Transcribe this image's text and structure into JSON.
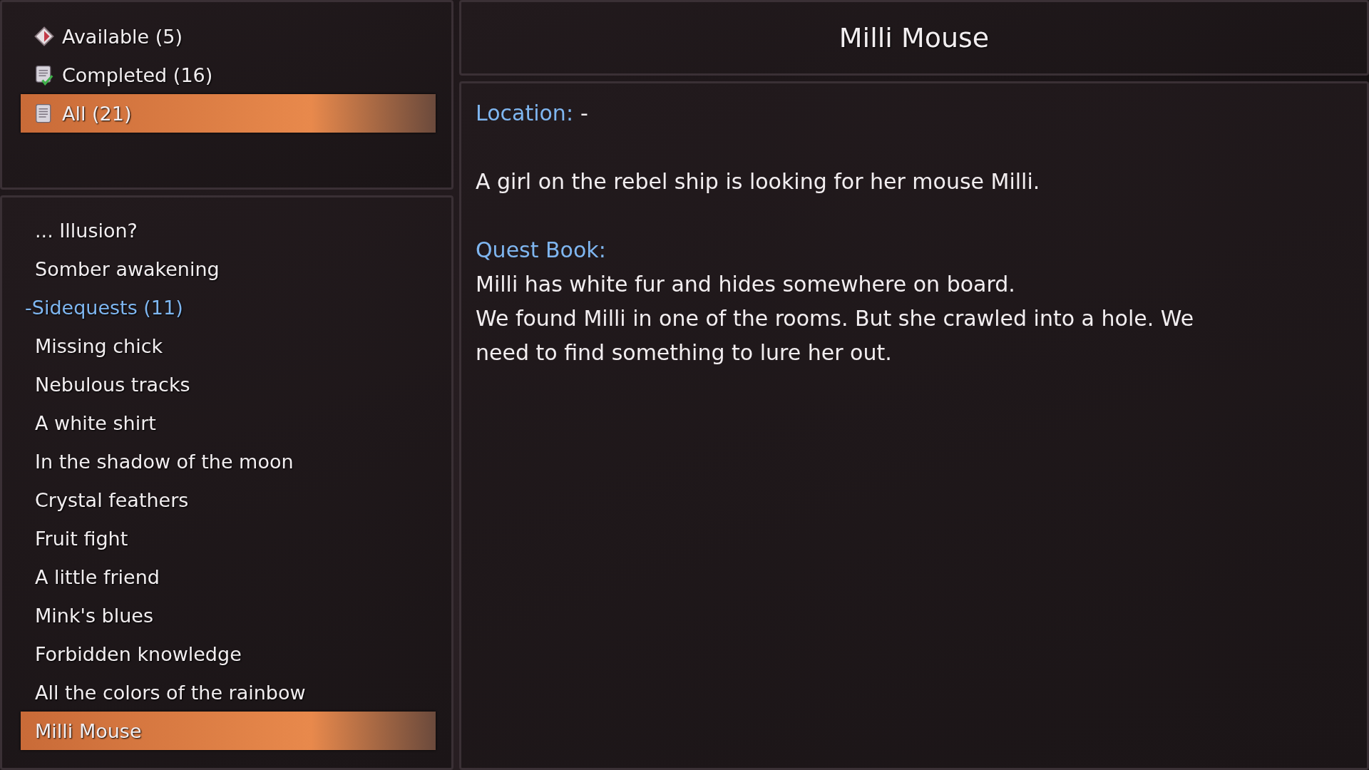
{
  "filters": [
    {
      "label": "Available (5)",
      "kind": "available",
      "selected": false
    },
    {
      "label": "Completed (16)",
      "kind": "completed",
      "selected": false
    },
    {
      "label": "All (21)",
      "kind": "all",
      "selected": true
    }
  ],
  "quests": [
    {
      "kind": "quest",
      "label": "... Illusion?",
      "selected": false
    },
    {
      "kind": "quest",
      "label": "Somber awakening",
      "selected": false
    },
    {
      "kind": "category",
      "label": "-Sidequests (11)",
      "children": [
        {
          "label": "Missing chick",
          "selected": false
        },
        {
          "label": "Nebulous tracks",
          "selected": false
        },
        {
          "label": "A white shirt",
          "selected": false
        },
        {
          "label": "In the shadow of the moon",
          "selected": false
        },
        {
          "label": "Crystal feathers",
          "selected": false
        },
        {
          "label": "Fruit fight",
          "selected": false
        },
        {
          "label": "A little friend",
          "selected": false
        },
        {
          "label": "Mink's blues",
          "selected": false
        },
        {
          "label": "Forbidden knowledge",
          "selected": false
        },
        {
          "label": "All the colors of the rainbow",
          "selected": false
        },
        {
          "label": "Milli Mouse",
          "selected": true
        }
      ]
    }
  ],
  "detail": {
    "title": "Milli Mouse",
    "location_label": "Location:",
    "location_value": "-",
    "description": "A girl on the rebel ship is looking for her mouse Milli.",
    "quest_book_label": "Quest Book:",
    "entries": [
      "Milli has white fur and hides somewhere on board.",
      "We found Milli in one of the rooms. But she crawled into a hole. We need to find something to lure her out."
    ]
  }
}
